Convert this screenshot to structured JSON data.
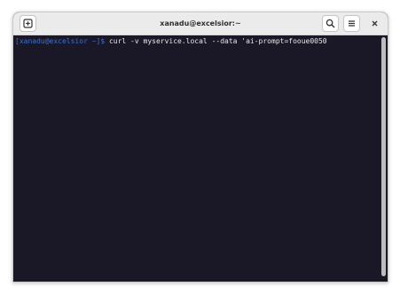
{
  "window": {
    "title": "xanadu@excelsior:~"
  },
  "toolbar": {
    "new_tab_icon": "new-tab-icon",
    "search_icon": "search-icon",
    "menu_icon": "hamburger-menu-icon",
    "close_icon": "close-icon"
  },
  "terminal": {
    "prompt": "[xanadu@excelsior ~]$",
    "command": " curl -v myservice.local --data 'ai-prompt=fooue0050",
    "prompt_color": "#3b6fd8",
    "background_color": "#1a1826",
    "text_color": "#e8e8e8"
  }
}
